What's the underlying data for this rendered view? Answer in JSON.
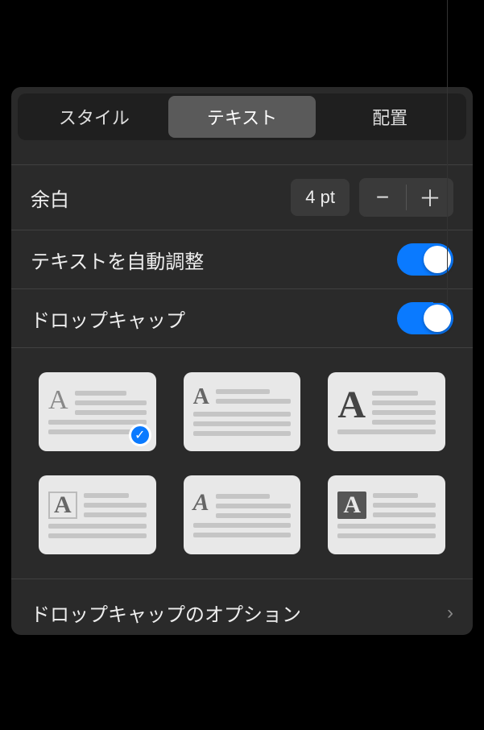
{
  "tabs": {
    "style": "スタイル",
    "text": "テキスト",
    "layout": "配置"
  },
  "margin": {
    "label": "余白",
    "value": "4 pt"
  },
  "autoFit": {
    "label": "テキストを自動調整",
    "enabled": true
  },
  "dropCap": {
    "label": "ドロップキャップ",
    "enabled": true
  },
  "stylePreviews": {
    "letter": "A",
    "selectedIndex": 0
  },
  "options": {
    "label": "ドロップキャップのオプション"
  },
  "icons": {
    "minus": "−",
    "plus": "＋",
    "check": "✓",
    "chevron": "›"
  }
}
